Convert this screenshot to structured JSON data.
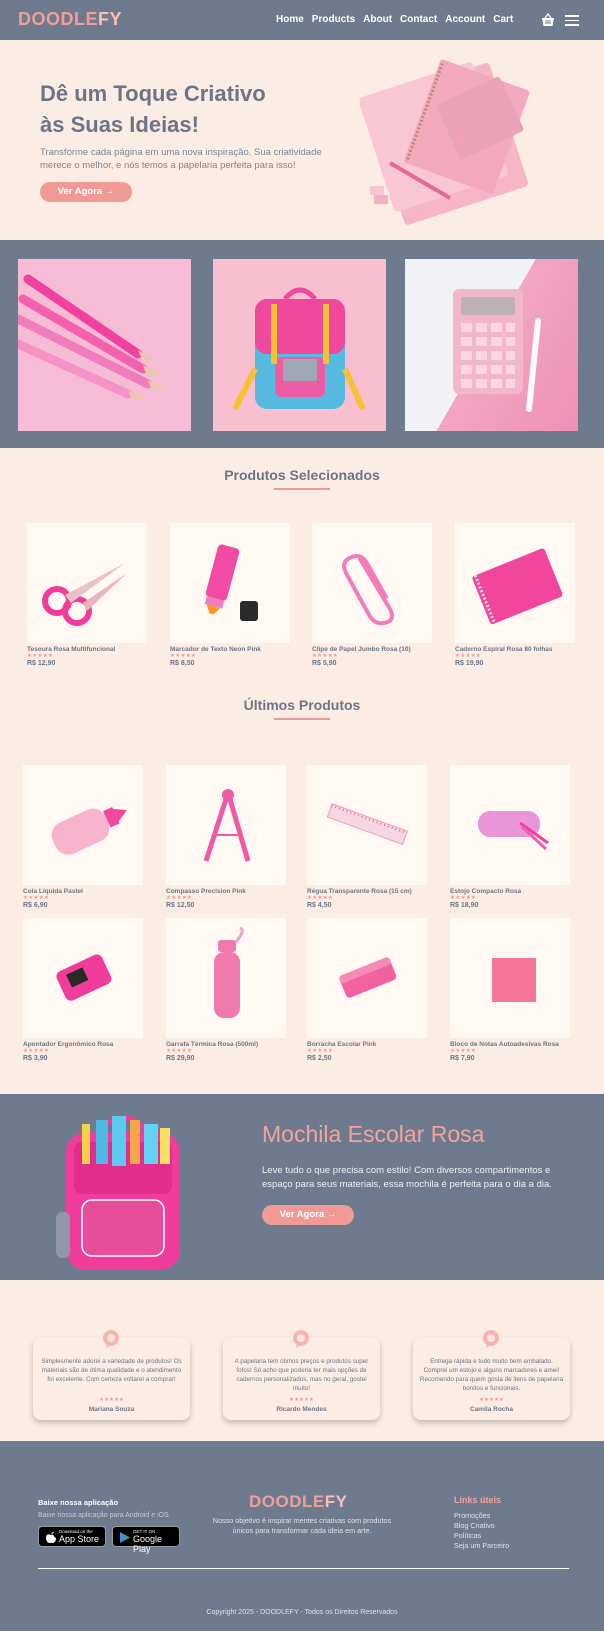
{
  "brand": {
    "logo_main": "DOODLE",
    "logo_accent": "FY"
  },
  "nav": {
    "links": [
      "Home",
      "Products",
      "About",
      "Contact",
      "Account",
      "Cart"
    ],
    "cart_icon": "basket-icon",
    "menu_icon": "hamburger-icon"
  },
  "hero": {
    "title_line1": "Dê um Toque Criativo",
    "title_line2": "às Suas Ideias!",
    "subtitle": "Transforme cada página em uma nova inspiração. Sua criatividade merece o melhor, e nós temos a papelaria perfeita para isso!",
    "cta": "Ver Agora →"
  },
  "selected": {
    "title": "Produtos Selecionados",
    "items": [
      {
        "name": "Tesoura Rosa Multifuncional",
        "stars": "★★★★★",
        "price": "R$ 12,90"
      },
      {
        "name": "Marcador de Texto Neon Pink",
        "stars": "★★★★★",
        "price": "R$ 8,50"
      },
      {
        "name": "Clipe de Papel Jumbo Rosa (10)",
        "stars": "★★★★★",
        "price": "R$ 5,90"
      },
      {
        "name": "Caderno Espiral Rosa 80 folhas",
        "stars": "★★★★★",
        "price": "R$ 19,90"
      }
    ]
  },
  "latest": {
    "title": "Últimos Produtos",
    "items": [
      {
        "name": "Cola Líquida Pastel",
        "stars": "★★★★★",
        "price": "R$ 6,90"
      },
      {
        "name": "Compasso Precision Pink",
        "stars": "★★★★★",
        "price": "R$ 12,50"
      },
      {
        "name": "Régua Transparente Rosa (15 cm)",
        "stars": "★★★★★",
        "price": "R$ 4,50"
      },
      {
        "name": "Estojo Compacto Rosa",
        "stars": "★★★★★",
        "price": "R$ 18,90"
      },
      {
        "name": "Apontador Ergonômico Rosa",
        "stars": "★★★★★",
        "price": "R$ 3,90"
      },
      {
        "name": "Garrafa Térmica Rosa (500ml)",
        "stars": "★★★★★",
        "price": "R$ 29,90"
      },
      {
        "name": "Borracha Escolar Pink",
        "stars": "★★★★★",
        "price": "R$ 2,50"
      },
      {
        "name": "Bloco de Notas Autoadesivas Rosa",
        "stars": "★★★★★",
        "price": "R$ 7,90"
      }
    ]
  },
  "feature": {
    "title": "Mochila Escolar Rosa",
    "text": "Leve tudo o que precisa com estilo! Com diversos compartimentos e espaço para seus materiais, essa mochila é perfeita para o dia a dia.",
    "cta": "Ver Agora →"
  },
  "testimonials": [
    {
      "text": "Simplesmente adorei a variedade de produtos! Os materiais são de ótima qualidade e o atendimento foi excelente. Com certeza voltarei a comprar!",
      "stars": "★★★★★",
      "author": "Mariana Souza"
    },
    {
      "text": "A papelaria tem ótimos preços e produtos super fofos! Só acho que poderia ter mais opções de cadernos personalizados, mas no geral, gostei muito!",
      "stars": "★★★★★",
      "author": "Ricardo Mendes"
    },
    {
      "text": "Entrega rápida e tudo muito bem embalado. Comprei um estojo e alguns marcadores e amei! Recomendo para quem gosta de itens de papelaria bonitos e funcionais.",
      "stars": "★★★★★",
      "author": "Camila Rocha"
    }
  ],
  "footer": {
    "app_title": "Baixe nossa aplicação",
    "app_subtitle": "Baixe nossa aplicação para Android e iOS",
    "appstore_small": "Download on the",
    "appstore_big": "App Store",
    "googleplay_small": "GET IT ON",
    "googleplay_big": "Google Play",
    "description": "Nosso objetivo é inspirar mentes criativas com produtos únicos para transformar cada ideia em arte.",
    "links_title": "Links úteis",
    "links": [
      "Promoções",
      "Blog Criativo",
      "Políticas",
      "Seja um Parceiro"
    ],
    "copyright": "Copyright 2025 - DOODLEFY - Todos os Direitos Reservados"
  },
  "colors": {
    "slate": "#6e7a8d",
    "cream": "#fcede4",
    "coral": "#ef9a95",
    "pink": "#f03c9a"
  }
}
